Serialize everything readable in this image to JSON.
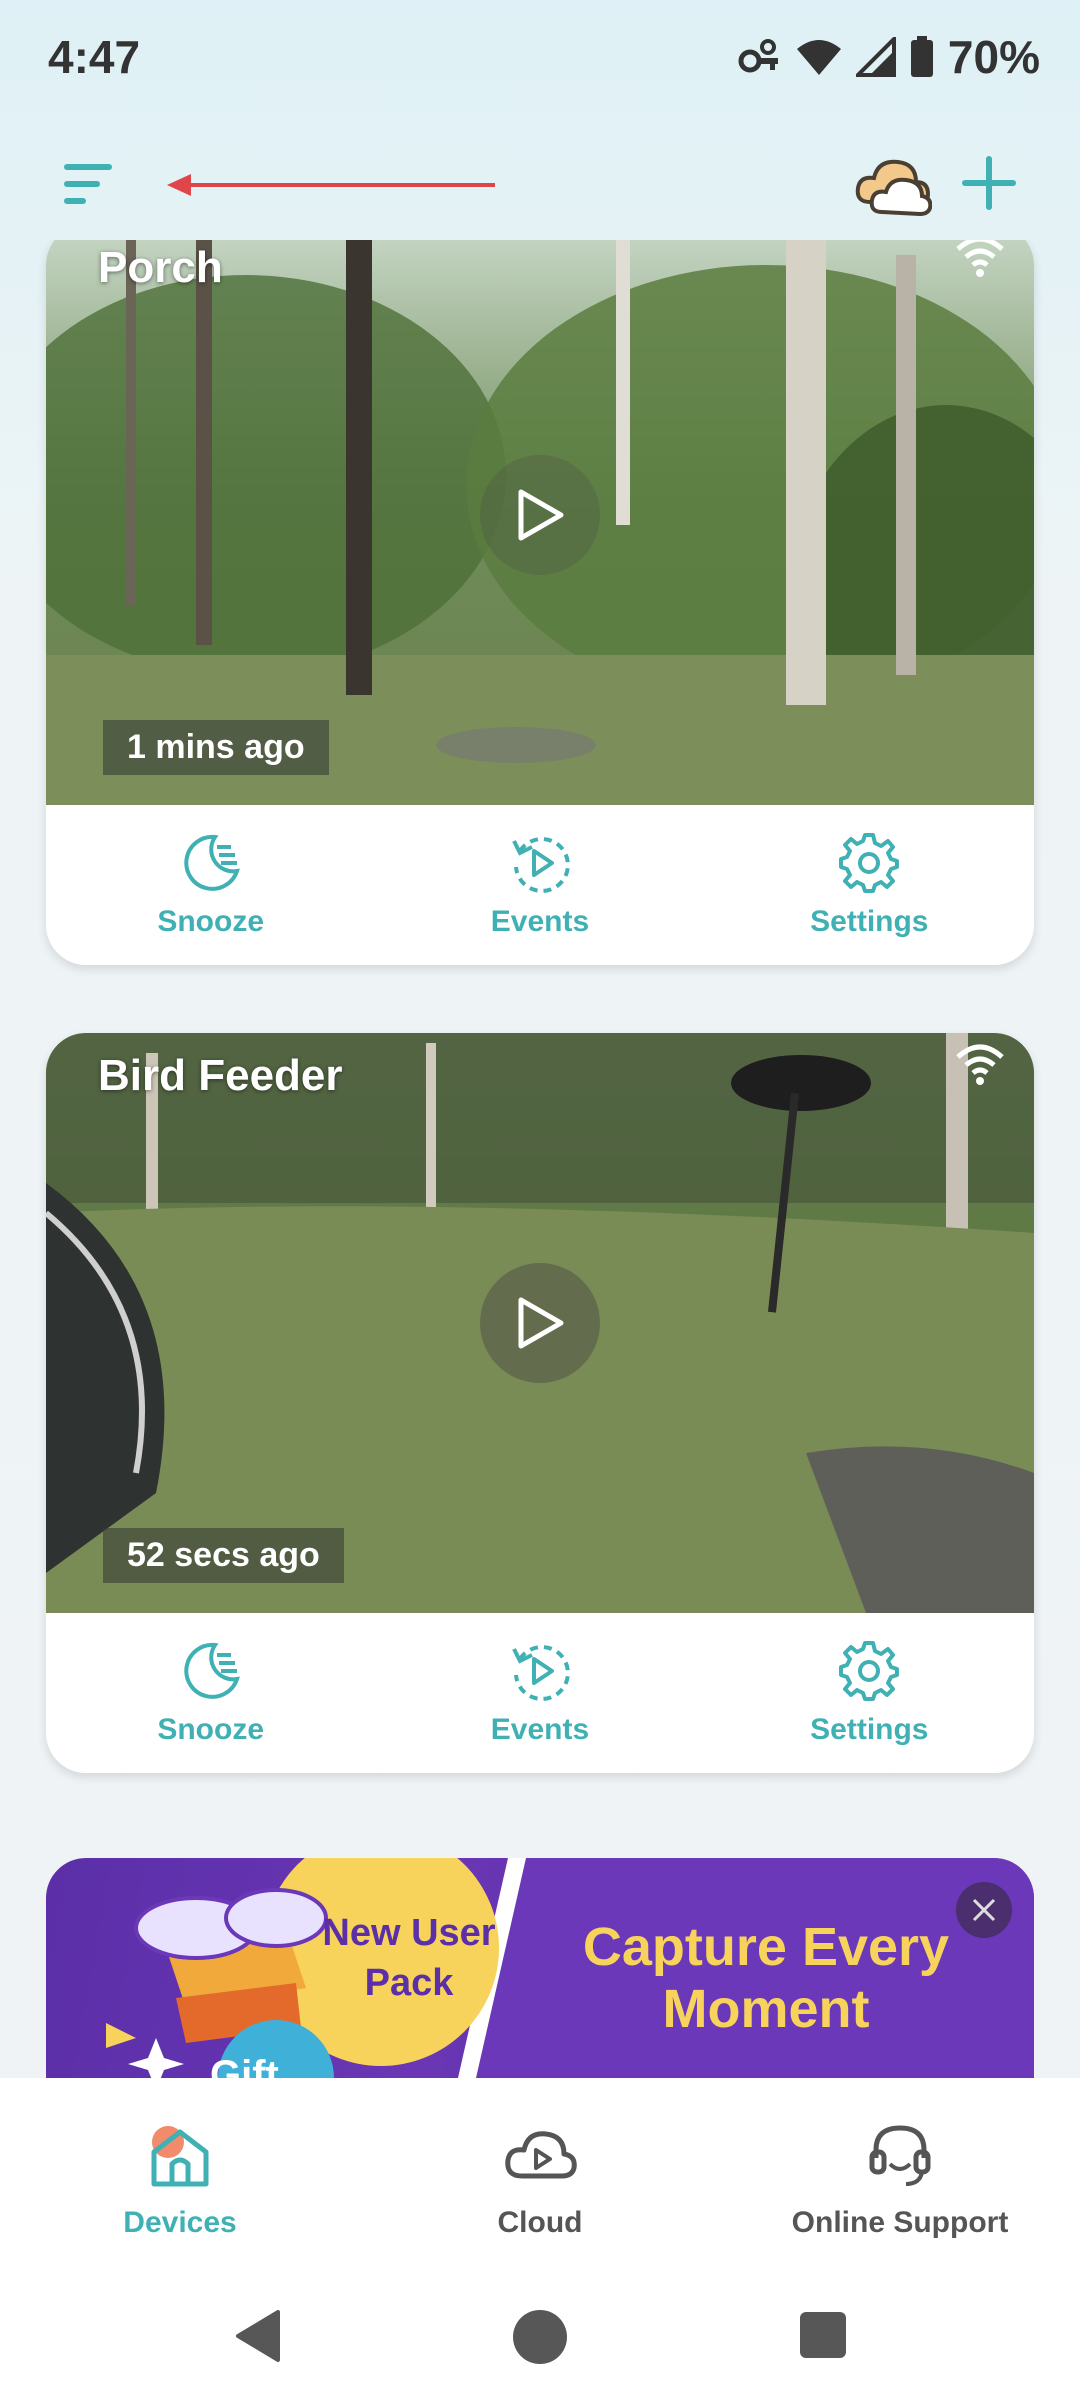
{
  "status_bar": {
    "time": "4:47",
    "battery": "70%",
    "icons": [
      "vpn-key-icon",
      "wifi-icon",
      "cell-signal-icon",
      "battery-icon"
    ]
  },
  "header": {
    "menu_icon": "menu-icon",
    "cloud_icon": "cloud-status-icon",
    "add_icon": "plus-icon"
  },
  "cameras": [
    {
      "name": "Porch",
      "last_event": "1 mins ago",
      "actions": [
        {
          "label": "Snooze",
          "icon": "snooze-moon-icon"
        },
        {
          "label": "Events",
          "icon": "events-replay-icon"
        },
        {
          "label": "Settings",
          "icon": "gear-icon"
        }
      ]
    },
    {
      "name": "Bird Feeder",
      "last_event": "52 secs ago",
      "actions": [
        {
          "label": "Snooze",
          "icon": "snooze-moon-icon"
        },
        {
          "label": "Events",
          "icon": "events-replay-icon"
        },
        {
          "label": "Settings",
          "icon": "gear-icon"
        }
      ]
    }
  ],
  "promo": {
    "badge_line1": "New User",
    "badge_line2": "Pack",
    "headline_line1": "Capture Every",
    "headline_line2": "Moment",
    "gift_label": "Gift"
  },
  "bottom_nav": {
    "items": [
      {
        "label": "Devices",
        "active": true,
        "icon": "home-icon"
      },
      {
        "label": "Cloud",
        "active": false,
        "icon": "cloud-play-icon"
      },
      {
        "label": "Online Support",
        "active": false,
        "icon": "headset-icon"
      }
    ]
  },
  "colors": {
    "accent": "#3fb0b3",
    "promo_bg": "#5b2fa8",
    "promo_text": "#f7d35c",
    "annotation_arrow": "#e0454a"
  }
}
